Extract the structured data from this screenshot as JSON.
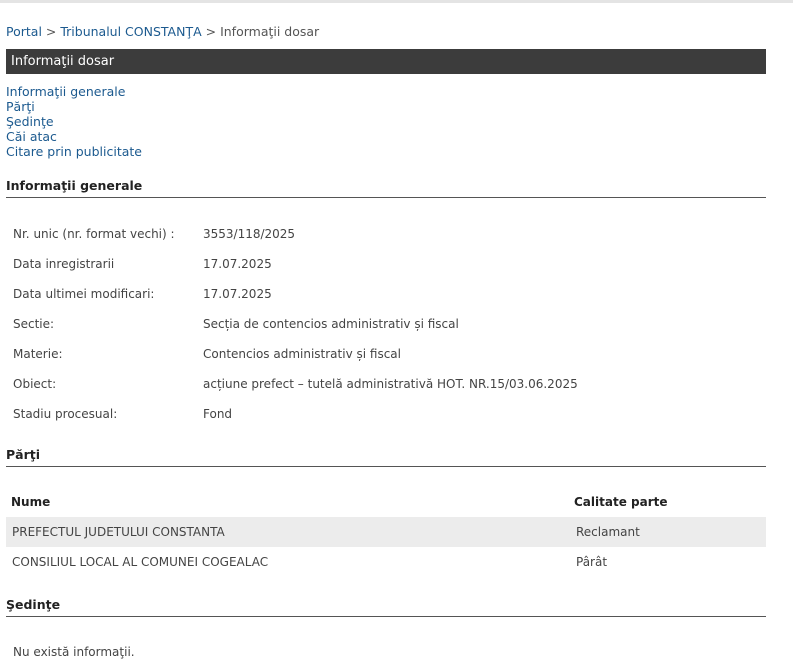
{
  "breadcrumb": {
    "portal": "Portal",
    "sep1": " > ",
    "court": "Tribunalul CONSTANŢA",
    "sep2": " > ",
    "current": "Informaţii dosar"
  },
  "title": "Informaţii dosar",
  "nav": {
    "items": [
      {
        "label": "Informaţii generale"
      },
      {
        "label": "Părţi"
      },
      {
        "label": "Şedinţe"
      },
      {
        "label": "Căi atac"
      },
      {
        "label": "Citare prin publicitate"
      }
    ]
  },
  "general": {
    "heading": "Informaţii generale",
    "rows": [
      {
        "label": "Nr. unic (nr. format vechi) :",
        "value": "3553/118/2025"
      },
      {
        "label": "Data inregistrarii",
        "value": "17.07.2025"
      },
      {
        "label": "Data ultimei modificari:",
        "value": "17.07.2025"
      },
      {
        "label": "Sectie:",
        "value": "Secția de contencios administrativ și fiscal"
      },
      {
        "label": "Materie:",
        "value": "Contencios administrativ și fiscal"
      },
      {
        "label": "Obiect:",
        "value": "acțiune prefect – tutelă administrativă HOT. NR.15/03.06.2025"
      },
      {
        "label": "Stadiu procesual:",
        "value": "Fond"
      }
    ]
  },
  "parties": {
    "heading": "Părţi",
    "col_name": "Nume",
    "col_role": "Calitate parte",
    "rows": [
      {
        "name": "PREFECTUL JUDETULUI CONSTANTA",
        "role": "Reclamant"
      },
      {
        "name": "CONSILIUL LOCAL AL COMUNEI COGEALAC",
        "role": "Pârât"
      }
    ]
  },
  "hearings": {
    "heading": "Şedinţe",
    "empty": "Nu există informaţii."
  }
}
